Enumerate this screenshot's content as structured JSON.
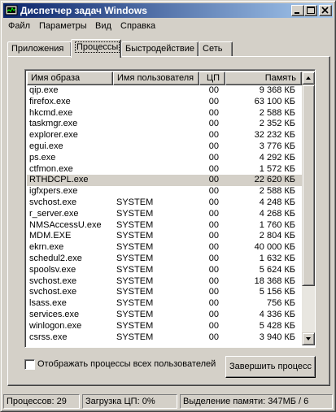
{
  "window": {
    "title": "Диспетчер задач Windows"
  },
  "menu": {
    "items": [
      "Файл",
      "Параметры",
      "Вид",
      "Справка"
    ]
  },
  "tabs": [
    {
      "label": "Приложения",
      "active": false
    },
    {
      "label": "Процессы",
      "active": true
    },
    {
      "label": "Быстродействие",
      "active": false
    },
    {
      "label": "Сеть",
      "active": false
    }
  ],
  "table": {
    "columns": [
      "Имя образа",
      "Имя пользователя",
      "ЦП",
      "Память"
    ],
    "selected_row": 8,
    "rows": [
      [
        "qip.exe",
        "",
        "00",
        "9 368 КБ"
      ],
      [
        "firefox.exe",
        "",
        "00",
        "63 100 КБ"
      ],
      [
        "hkcmd.exe",
        "",
        "00",
        "2 588 КБ"
      ],
      [
        "taskmgr.exe",
        "",
        "00",
        "2 352 КБ"
      ],
      [
        "explorer.exe",
        "",
        "00",
        "32 232 КБ"
      ],
      [
        "egui.exe",
        "",
        "00",
        "3 776 КБ"
      ],
      [
        "ps.exe",
        "",
        "00",
        "4 292 КБ"
      ],
      [
        "ctfmon.exe",
        "",
        "00",
        "1 572 КБ"
      ],
      [
        "RTHDCPL.exe",
        "",
        "00",
        "22 620 КБ"
      ],
      [
        "igfxpers.exe",
        "",
        "00",
        "2 588 КБ"
      ],
      [
        "svchost.exe",
        "SYSTEM",
        "00",
        "4 248 КБ"
      ],
      [
        "r_server.exe",
        "SYSTEM",
        "00",
        "4 268 КБ"
      ],
      [
        "NMSAccessU.exe",
        "SYSTEM",
        "00",
        "1 760 КБ"
      ],
      [
        "MDM.EXE",
        "SYSTEM",
        "00",
        "2 804 КБ"
      ],
      [
        "ekrn.exe",
        "SYSTEM",
        "00",
        "40 000 КБ"
      ],
      [
        "schedul2.exe",
        "SYSTEM",
        "00",
        "1 632 КБ"
      ],
      [
        "spoolsv.exe",
        "SYSTEM",
        "00",
        "5 624 КБ"
      ],
      [
        "svchost.exe",
        "SYSTEM",
        "00",
        "18 368 КБ"
      ],
      [
        "svchost.exe",
        "SYSTEM",
        "00",
        "5 156 КБ"
      ],
      [
        "lsass.exe",
        "SYSTEM",
        "00",
        "756 КБ"
      ],
      [
        "services.exe",
        "SYSTEM",
        "00",
        "4 336 КБ"
      ],
      [
        "winlogon.exe",
        "SYSTEM",
        "00",
        "5 428 КБ"
      ],
      [
        "csrss.exe",
        "SYSTEM",
        "00",
        "3 940 КБ"
      ]
    ]
  },
  "show_all_users_label": "Отображать процессы всех пользователей",
  "show_all_users_checked": false,
  "end_process_label": "Завершить процесс",
  "status": {
    "processes": "Процессов: 29",
    "cpu": "Загрузка ЦП: 0%",
    "memory": "Выделение памяти: 347МБ / 6"
  },
  "icons": {
    "app": "taskmgr-icon",
    "minimize": "minimize-icon",
    "maximize": "maximize-icon",
    "close": "close-icon",
    "scroll_up": "arrow-up-icon",
    "scroll_down": "arrow-down-icon"
  },
  "colors": {
    "title_start": "#0a246a",
    "title_end": "#a6caf0",
    "face": "#d4d0c8"
  }
}
